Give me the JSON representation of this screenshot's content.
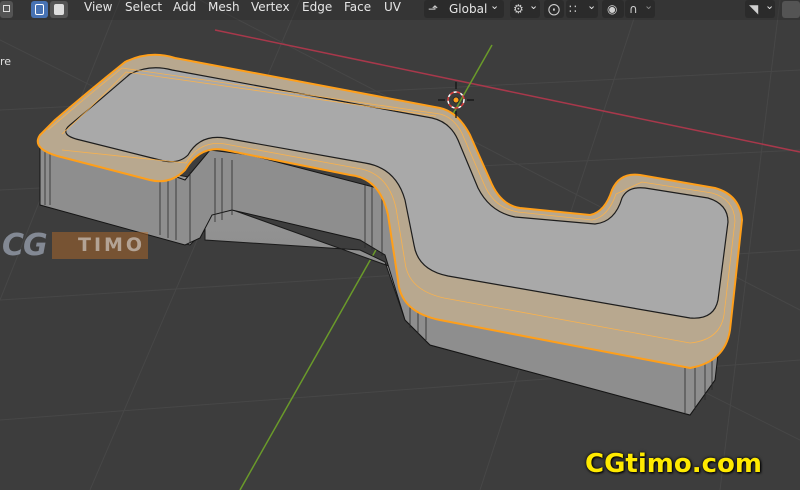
{
  "header": {
    "menu": [
      "View",
      "Select",
      "Add",
      "Mesh",
      "Vertex",
      "Edge",
      "Face",
      "UV"
    ],
    "orientation": "Global",
    "dropdown_arrow": "⌄"
  },
  "icons": {
    "select_mode_vertex": "vertex-select-icon",
    "select_mode_edge": "edge-select-icon",
    "select_mode_face": "face-select-icon",
    "transform_orientation": "transform-orientation-icon",
    "pivot": "pivot-point-icon",
    "snap": "snap-icon",
    "snap_target": "snap-target-icon",
    "proportional": "proportional-editing-icon",
    "falloff": "falloff-icon",
    "visibility": "visibility-icon"
  },
  "viewport": {
    "left_edge_text": "re",
    "colors": {
      "background": "#3d3d3d",
      "grid": "#4a4a4a",
      "x_axis": "#a8384b",
      "y_axis": "#6a9a2a",
      "selection": "#ff9f1a",
      "mesh_top": "#a6a6a6",
      "mesh_side": "#8a8a8a"
    }
  },
  "watermarks": {
    "top_letters": "CG",
    "top_box": "TIMO",
    "bottom": "CGtimo.com"
  }
}
